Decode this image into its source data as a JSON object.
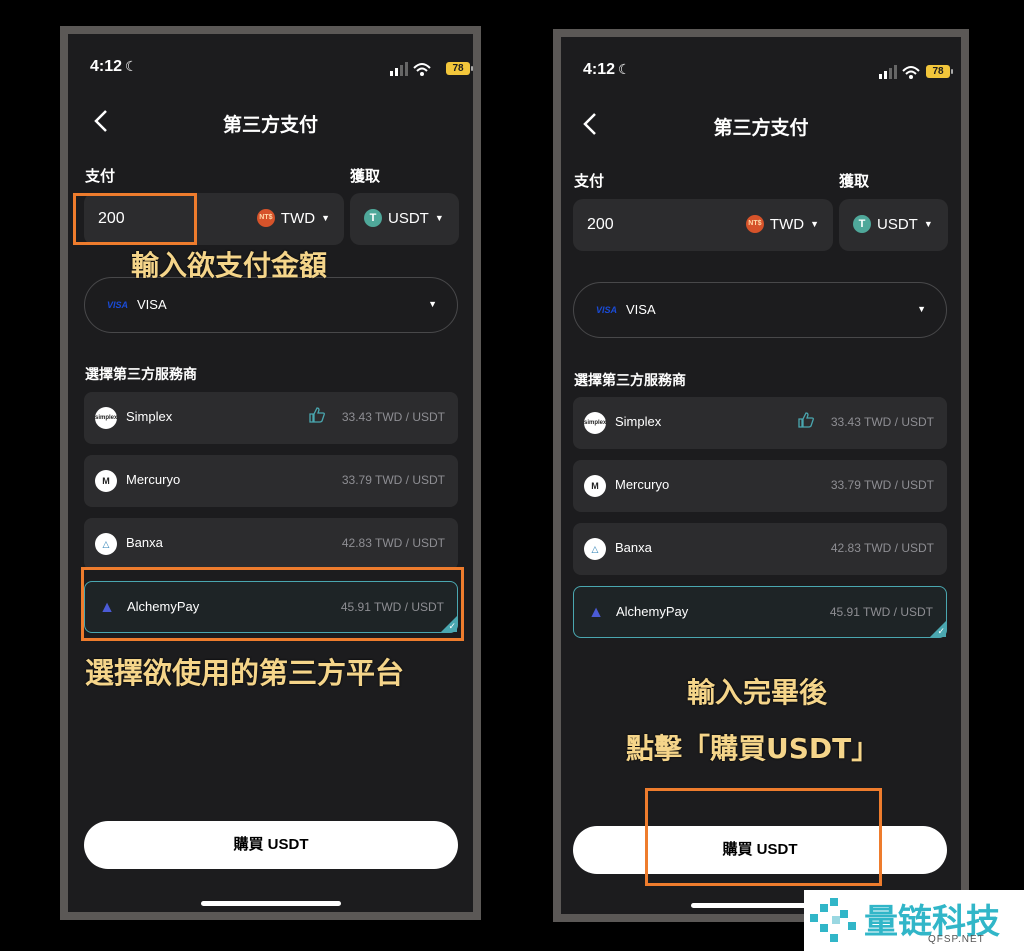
{
  "status": {
    "time": "4:12",
    "battery": "78"
  },
  "header": {
    "title": "第三方支付",
    "back_icon": "chevron-left-icon"
  },
  "form": {
    "pay_label": "支付",
    "receive_label": "獲取",
    "amount": "200",
    "pay_currency": "TWD",
    "pay_currency_badge": "NT$",
    "receive_currency": "USDT",
    "receive_currency_badge": "T",
    "payment_method": "VISA",
    "payment_method_logo": "VISA"
  },
  "providers_label": "選擇第三方服務商",
  "providers": [
    {
      "name": "Simplex",
      "rate": "33.43 TWD / USDT",
      "badge": "simplex",
      "recommended": true
    },
    {
      "name": "Mercuryo",
      "rate": "33.79 TWD / USDT",
      "badge": "M",
      "recommended": false
    },
    {
      "name": "Banxa",
      "rate": "42.83 TWD / USDT",
      "badge": "△",
      "recommended": false
    },
    {
      "name": "AlchemyPay",
      "rate": "45.91 TWD / USDT",
      "badge": "▲",
      "recommended": false,
      "selected": true
    }
  ],
  "buy_button": "購買 USDT",
  "annotations": {
    "enter_amount": "輸入欲支付金額",
    "select_platform": "選擇欲使用的第三方平台",
    "after_input_line1": "輸入完畢後",
    "after_input_line2": "點擊「購買USDT」"
  },
  "watermark": {
    "name": "量链科技",
    "domain": "QFSP.NET"
  },
  "colors": {
    "accent_orange": "#ee7c2d",
    "annotation_text": "#f5d58a",
    "selected_border": "#4aa7b0",
    "watermark": "#31b6c8"
  }
}
